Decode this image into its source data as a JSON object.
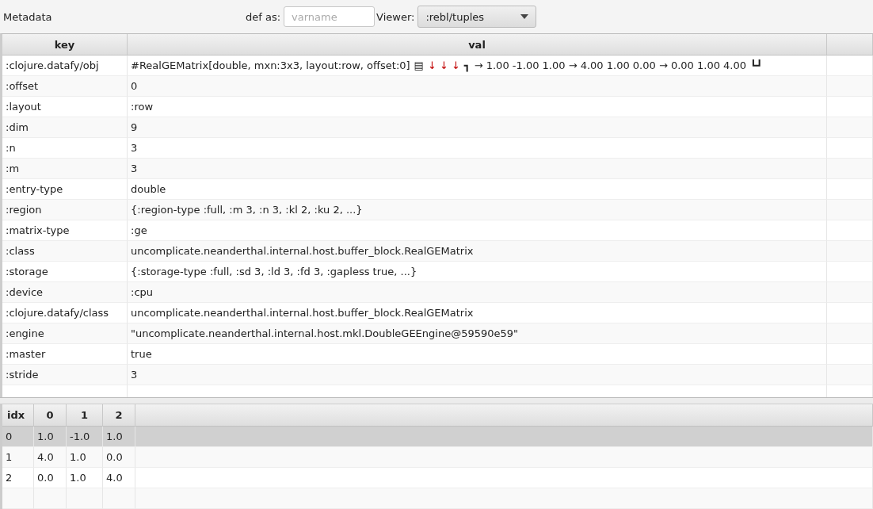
{
  "toolbar": {
    "title": "Metadata",
    "def_label": "def as:",
    "def_field": {
      "placeholder": "varname"
    },
    "viewer_label": "Viewer:",
    "viewer_select": {
      "value": ":rebl/tuples"
    }
  },
  "table": {
    "columns": [
      "key",
      "val"
    ],
    "rows": [
      {
        "key": ":clojure.datafy/obj",
        "val_parts": [
          {
            "kind": "text",
            "text": "#RealGEMatrix[double, mxn:3x3, layout:row, offset:0]"
          },
          {
            "kind": "glyph",
            "text": "▤"
          },
          {
            "kind": "marker",
            "text": "↓ ↓ ↓"
          },
          {
            "kind": "glyph",
            "text": "┓"
          },
          {
            "kind": "text",
            "text": "→ 1.00 -1.00 1.00 → 4.00 1.00 0.00 → 0.00 1.00 4.00"
          },
          {
            "kind": "glyph",
            "text": "┗┛"
          }
        ]
      },
      {
        "key": ":offset",
        "val": "0"
      },
      {
        "key": ":layout",
        "val": ":row"
      },
      {
        "key": ":dim",
        "val": "9"
      },
      {
        "key": ":n",
        "val": "3"
      },
      {
        "key": ":m",
        "val": "3"
      },
      {
        "key": ":entry-type",
        "val": "double"
      },
      {
        "key": ":region",
        "val": "{:region-type :full, :m 3, :n 3, :kl 2, :ku 2, ...}"
      },
      {
        "key": ":matrix-type",
        "val": ":ge"
      },
      {
        "key": ":class",
        "val": "uncomplicate.neanderthal.internal.host.buffer_block.RealGEMatrix"
      },
      {
        "key": ":storage",
        "val": "{:storage-type :full, :sd 3, :ld 3, :fd 3, :gapless true, ...}"
      },
      {
        "key": ":device",
        "val": ":cpu"
      },
      {
        "key": ":clojure.datafy/class",
        "val": "uncomplicate.neanderthal.internal.host.buffer_block.RealGEMatrix"
      },
      {
        "key": ":engine",
        "val": "\"uncomplicate.neanderthal.internal.host.mkl.DoubleGEEngine@59590e59\""
      },
      {
        "key": ":master",
        "val": "true"
      },
      {
        "key": ":stride",
        "val": "3"
      }
    ]
  },
  "matrix_table": {
    "columns": [
      "idx",
      "0",
      "1",
      "2"
    ],
    "rows": [
      {
        "cells": [
          "0",
          "1.0",
          "-1.0",
          "1.0"
        ],
        "selected": true
      },
      {
        "cells": [
          "1",
          "4.0",
          "1.0",
          "0.0"
        ],
        "selected": false
      },
      {
        "cells": [
          "2",
          "0.0",
          "1.0",
          "4.0"
        ],
        "selected": false
      }
    ]
  }
}
